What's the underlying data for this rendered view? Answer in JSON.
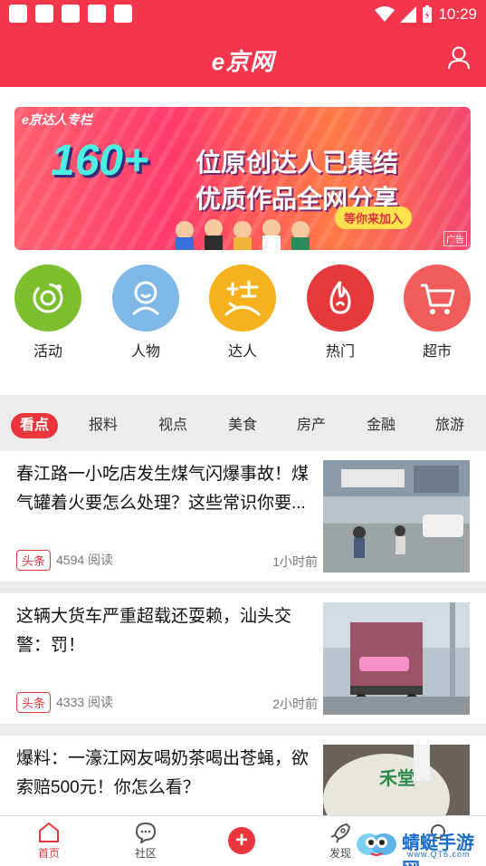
{
  "status_bar": {
    "time": "10:29"
  },
  "header": {
    "logo": "e京网"
  },
  "banner": {
    "tag": "e京达人专栏",
    "number": "160+",
    "line1": "位原创达人已集结",
    "line2": "优质作品全网分享",
    "button": "等你来加入",
    "ad_label": "广告"
  },
  "categories": [
    {
      "label": "活动",
      "color": "#7cbf2e",
      "icon": "planet-icon"
    },
    {
      "label": "人物",
      "color": "#7fb8e6",
      "icon": "person-icon"
    },
    {
      "label": "达人",
      "color": "#f5b21c",
      "icon": "daren-icon"
    },
    {
      "label": "热门",
      "color": "#e6393c",
      "icon": "flame-icon"
    },
    {
      "label": "超市",
      "color": "#f15c5c",
      "icon": "cart-icon"
    }
  ],
  "tabs": [
    "看点",
    "报料",
    "视点",
    "美食",
    "房产",
    "金融",
    "旅游"
  ],
  "news": [
    {
      "title": "春江路一小吃店发生煤气闪爆事故！煤气罐着火要怎么处理？这些常识你要...",
      "badge": "头条",
      "reads": "4594 阅读",
      "time": "1小时前"
    },
    {
      "title": "这辆大货车严重超载还耍赖，汕头交警：罚！",
      "badge": "头条",
      "reads": "4333 阅读",
      "time": "2小时前"
    },
    {
      "title": "爆料：一濠江网友喝奶茶喝出苍蝇，欲索赔500元！你怎么看？",
      "badge": "",
      "reads": "",
      "time": ""
    }
  ],
  "bottom_nav": {
    "home": "首页",
    "community": "社区",
    "discover": "发现"
  },
  "watermark": {
    "text": "蜻蜓手游网",
    "sub": "www.QT6.com"
  }
}
